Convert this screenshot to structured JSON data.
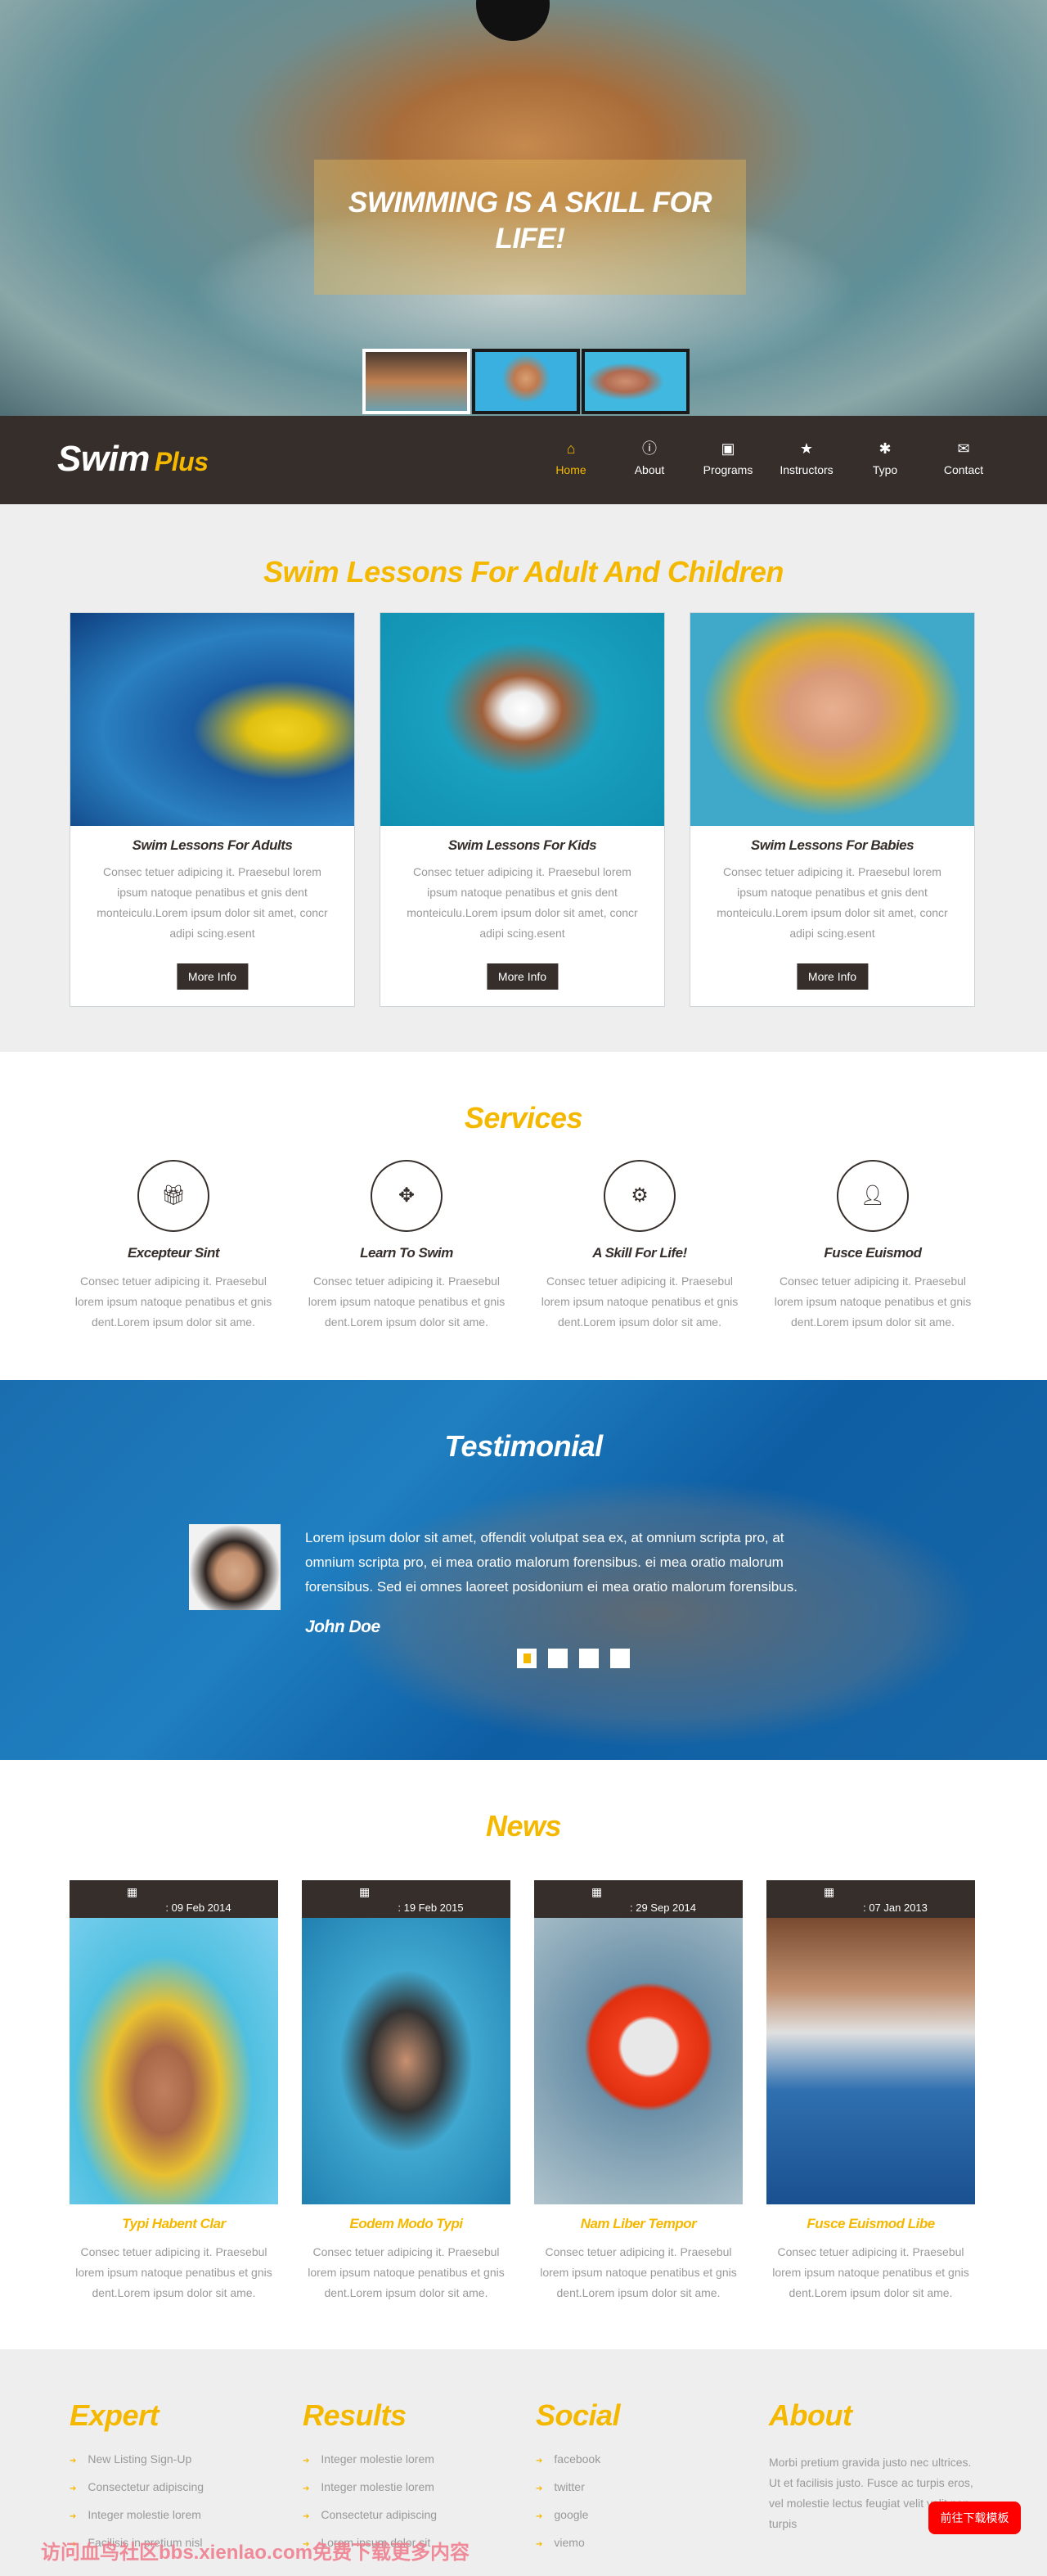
{
  "hero": {
    "title": "Swimming is a skill for life!",
    "thumbnails": [
      "butterfly-swimmer",
      "boy-with-goggles",
      "child-swimming"
    ],
    "active_thumbnail": 0
  },
  "brand": {
    "name": "Swim",
    "suffix": "Plus"
  },
  "nav": {
    "items": [
      {
        "label": "Home",
        "icon": "home-icon",
        "active": true
      },
      {
        "label": "About",
        "icon": "info-icon"
      },
      {
        "label": "Programs",
        "icon": "picture-icon"
      },
      {
        "label": "Instructors",
        "icon": "star-icon"
      },
      {
        "label": "Typo",
        "icon": "asterisk-icon"
      },
      {
        "label": "Contact",
        "icon": "envelope-icon"
      }
    ]
  },
  "lessons": {
    "title": "Swim Lessons For Adult And Children",
    "cards": [
      {
        "title": "Swim Lessons For Adults",
        "text": "Consec tetuer adipicing it. Praesebul lorem ipsum natoque penatibus et gnis dent monteiculu.Lorem ipsum dolor sit amet, concr adipi scing.esent",
        "button": "More Info"
      },
      {
        "title": "Swim Lessons For Kids",
        "text": "Consec tetuer adipicing it. Praesebul lorem ipsum natoque penatibus et gnis dent monteiculu.Lorem ipsum dolor sit amet, concr adipi scing.esent",
        "button": "More Info"
      },
      {
        "title": "Swim Lessons For Babies",
        "text": "Consec tetuer adipicing it. Praesebul lorem ipsum natoque penatibus et gnis dent monteiculu.Lorem ipsum dolor sit amet, concr adipi scing.esent",
        "button": "More Info"
      }
    ]
  },
  "services": {
    "title": "Services",
    "items": [
      {
        "title": "Excepteur Sint",
        "icon": "gift-icon",
        "text": "Consec tetuer adipicing it. Praesebul lorem ipsum natoque penatibus et gnis dent.Lorem ipsum dolor sit ame."
      },
      {
        "title": "Learn To Swim",
        "icon": "move-icon",
        "text": "Consec tetuer adipicing it. Praesebul lorem ipsum natoque penatibus et gnis dent.Lorem ipsum dolor sit ame."
      },
      {
        "title": "A Skill For Life!",
        "icon": "gear-icon",
        "text": "Consec tetuer adipicing it. Praesebul lorem ipsum natoque penatibus et gnis dent.Lorem ipsum dolor sit ame."
      },
      {
        "title": "Fusce Euismod",
        "icon": "user-icon",
        "text": "Consec tetuer adipicing it. Praesebul lorem ipsum natoque penatibus et gnis dent.Lorem ipsum dolor sit ame."
      }
    ]
  },
  "testimonial": {
    "title": "Testimonial",
    "quote": "Lorem ipsum dolor sit amet, offendit volutpat sea ex, at omnium scripta pro, at omnium scripta pro, ei mea oratio malorum forensibus. ei mea oratio malorum forensibus. Sed ei omnes laoreet posidonium ei mea oratio malorum forensibus.",
    "author": "John Doe",
    "active_slide": 0,
    "slides": 4
  },
  "news": {
    "title": "News",
    "items": [
      {
        "date": ": 09 Feb 2014",
        "title": "Typi Habent Clar",
        "text": "Consec tetuer adipicing it. Praesebul lorem ipsum natoque penatibus et gnis dent.Lorem ipsum dolor sit ame."
      },
      {
        "date": ": 19 Feb 2015",
        "title": "Eodem Modo Typi",
        "text": "Consec tetuer adipicing it. Praesebul lorem ipsum natoque penatibus et gnis dent.Lorem ipsum dolor sit ame."
      },
      {
        "date": ": 29 Sep 2014",
        "title": "Nam Liber Tempor",
        "text": "Consec tetuer adipicing it. Praesebul lorem ipsum natoque penatibus et gnis dent.Lorem ipsum dolor sit ame."
      },
      {
        "date": ": 07 Jan 2013",
        "title": "Fusce Euismod Libe",
        "text": "Consec tetuer adipicing it. Praesebul lorem ipsum natoque penatibus et gnis dent.Lorem ipsum dolor sit ame."
      }
    ]
  },
  "footer": {
    "expert": {
      "title": "Expert",
      "items": [
        "New Listing Sign-Up",
        "Consectetur adipiscing",
        "Integer molestie lorem",
        "Facilisis in pretium nisl"
      ]
    },
    "results": {
      "title": "Results",
      "items": [
        "Integer molestie lorem",
        "Integer molestie lorem",
        "Consectetur adipiscing",
        "Lorem ipsum dolor sit"
      ]
    },
    "social": {
      "title": "Social",
      "items": [
        "facebook",
        "twitter",
        "google",
        "viemo"
      ]
    },
    "about": {
      "title": "About",
      "text": "Morbi pretium gravida justo nec ultrices. Ut et facilisis justo. Fusce ac turpis eros, vel molestie lectus feugiat velit velit non turpis"
    }
  },
  "download_button": "前往下载模板",
  "watermark": "访问血鸟社区bbs.xienlao.com免费下载更多内容",
  "colors": {
    "accent": "#f5b800",
    "dark": "#352e2b",
    "light_bg": "#eeeeee"
  }
}
